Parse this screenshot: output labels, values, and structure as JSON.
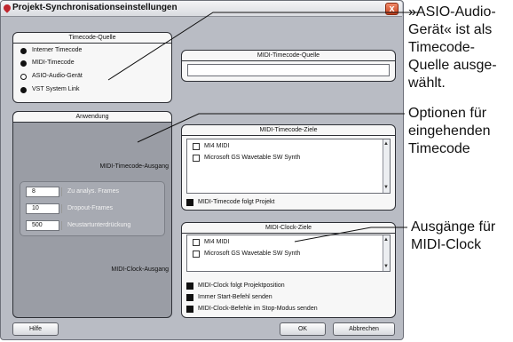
{
  "window": {
    "title": "Projekt-Synchronisationseinstellungen",
    "close_glyph": "x"
  },
  "timecode_source": {
    "title": "Timecode-Quelle",
    "options": [
      "Interner Timecode",
      "MIDI-Timecode",
      "ASIO-Audio-Gerät",
      "VST System Link"
    ],
    "selected": "ASIO-Audio-Gerät"
  },
  "midi_timecode_source": {
    "title": "MIDI-Timecode-Quelle",
    "value": ""
  },
  "anwendung": {
    "title": "Anwendung",
    "midi_timecode_output": "MIDI-Timecode-Ausgang",
    "midi_clock_output": "MIDI-Clock-Ausgang",
    "fields": [
      {
        "value": "8",
        "label": "Zu analys. Frames"
      },
      {
        "value": "10",
        "label": "Dropout-Frames"
      },
      {
        "value": "500",
        "label": "Neustartunterdrückung"
      }
    ]
  },
  "midi_timecode_targets": {
    "title": "MIDI-Timecode-Ziele",
    "items": [
      "MI4 MIDI",
      "Microsoft GS Wavetable SW Synth"
    ],
    "follow_label": "MIDI-Timecode folgt Projekt",
    "follow_checked": true
  },
  "midi_clock_targets": {
    "title": "MIDI-Clock-Ziele",
    "items": [
      "MI4 MIDI",
      "Microsoft GS Wavetable SW Synth"
    ],
    "options": [
      {
        "label": "MIDI-Clock folgt Projektposition",
        "checked": true
      },
      {
        "label": "Immer Start-Befehl senden",
        "checked": true
      },
      {
        "label": "MIDI-Clock-Befehle im Stop-Modus senden",
        "checked": true
      }
    ]
  },
  "buttons": {
    "help": "Hilfe",
    "ok": "OK",
    "cancel": "Abbrechen"
  },
  "annotations": {
    "asio_line1": "»ASIO-Audio-",
    "asio_line2": "Gerät« ist als",
    "asio_line3": "Timecode-",
    "asio_line4": "Quelle ausge-",
    "asio_line5": "wählt.",
    "options_line1": "Optionen für",
    "options_line2": "eingehenden",
    "options_line3": "Timecode",
    "outputs_line1": "Ausgänge für",
    "outputs_line2": "MIDI-Clock"
  },
  "colors": {
    "dialog_bg": "#b9bcc4",
    "panel_bg": "#f7f7f7",
    "anwendung_bg": "#9a9da5",
    "close_button": "#d9542b"
  }
}
